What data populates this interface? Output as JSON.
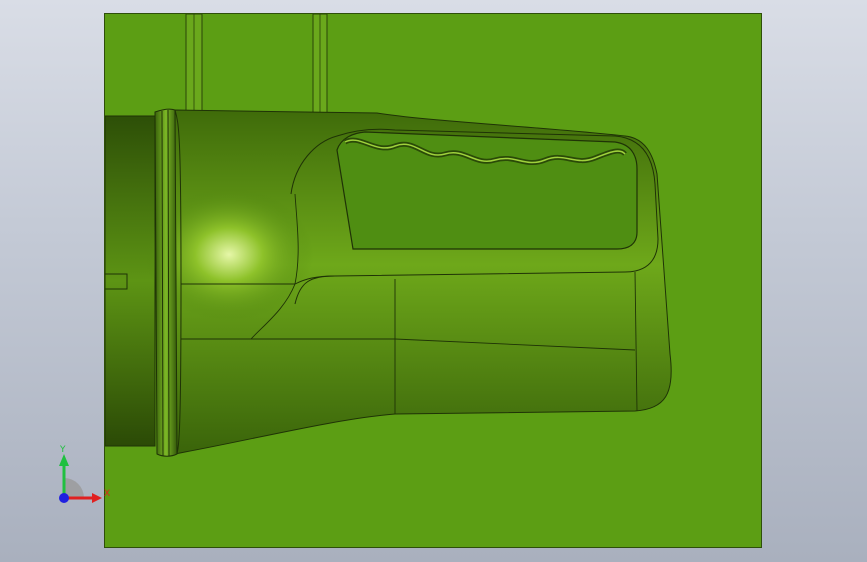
{
  "viewport": {
    "background_colors": [
      "#d9dde6",
      "#a9b0be"
    ],
    "model_color": "#5c9e14",
    "edge_color": "#1f3306"
  },
  "triad": {
    "x_label": "X",
    "y_label": "Y",
    "x_color": "#e02020",
    "y_color": "#20c040",
    "z_color": "#2020e0"
  }
}
